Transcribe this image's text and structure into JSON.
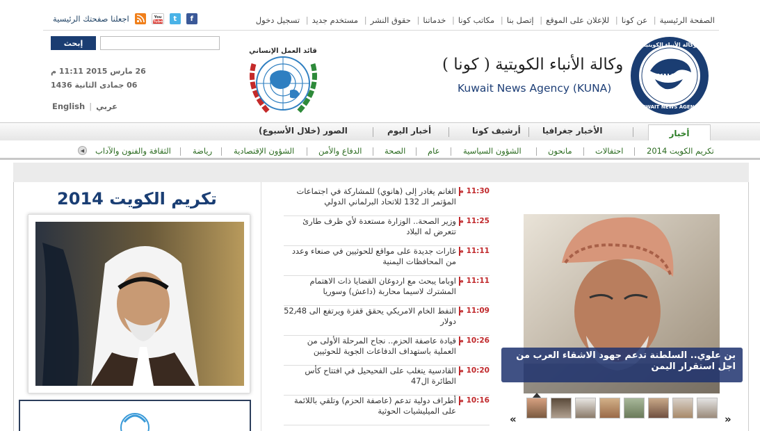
{
  "top_links": [
    "الصفحة الرئيسية",
    "عن كونا",
    "للإعلان على الموقع",
    "إتصل بنا",
    "مكاتب كونا",
    "خدماتنا",
    "حقوق النشر",
    "مستخدم جديد",
    "تسجيل دخول"
  ],
  "social": {
    "home_link": "اجعلنا صفحتك الرئيسية",
    "icons": [
      "rss-icon",
      "youtube-icon",
      "twitter-icon",
      "facebook-icon"
    ],
    "youtube_label": "You Tube"
  },
  "header": {
    "agency_ar": "وكالة الأنباء الكويتية ( كونا )",
    "agency_en": "Kuwait News Agency (KUNA)",
    "logo_text_top": "وكالة الأنباء الكويتية",
    "logo_text_mid": "KUNA",
    "logo_text_bottom": "KUWAIT NEWS AGENCY",
    "un_logo_text": "قائد العمل الإنساني",
    "search_button": "إبحث",
    "search_placeholder": "",
    "date_gregorian": "26 مارس 2015 11:11 م",
    "date_hijri": "06 جمادى الثانية 1436",
    "lang_en": "English",
    "lang_ar": "عربي"
  },
  "nav": {
    "tabs": [
      "أخبار",
      "الأخبار جغرافيا",
      "أرشيف كونا",
      "أخبار اليوم",
      "الصور (خلال الأسبوع)"
    ]
  },
  "subnav": {
    "items": [
      "تكريم الكويت 2014",
      "احتفالات",
      "مانحون",
      "الشؤون السياسية",
      "عام",
      "الصحة",
      "الدفاع والأمن",
      "الشؤون الإقتصادية",
      "رياضة",
      "الثقافة والفنون والآداب"
    ]
  },
  "left": {
    "title": "تكريم الكويت 2014"
  },
  "news": [
    {
      "time": "11:30 م",
      "text": "الغانم يغادر إلى (هانوي) للمشاركة في اجتماعات المؤتمر الـ 132 للاتحاد البرلماني الدولي"
    },
    {
      "time": "11:25 م",
      "text": "وزير الصحة.. الوزارة مستعدة لأي ظرف طارئ تتعرض له البلاد"
    },
    {
      "time": "11:11 م",
      "text": "غارات جديدة على مواقع للحوثيين في صنعاء وعدد من المحافظات اليمنية"
    },
    {
      "time": "11:11 م",
      "text": "اوباما يبحث مع اردوغان القضايا ذات الاهتمام المشترك لاسيما محاربة (داعش) وسوريا"
    },
    {
      "time": "11:09 م",
      "text": "النفط الخام الامريكي يحقق قفزة ويرتفع الى 52٫48 دولار"
    },
    {
      "time": "10:26 م",
      "text": "قيادة عاصفة الحزم.. نجاح المرحلة الأولى من العملية باستهداف الدفاعات الجوية للحوثيين"
    },
    {
      "time": "10:20 م",
      "text": "القادسية يتغلب على الفحيحيل في افتتاح كأس الطائرة ال47"
    },
    {
      "time": "10:16 م",
      "text": "أطراف دولية تدعم (عاصفة الحزم) وتلقي باللائمة على الميليشيات الحوثية"
    }
  ],
  "feature": {
    "caption": "بن علوي.. السلطنة تدعم جهود الاشقاء العرب من اجل استقرار اليمن",
    "prev_arrow": "«",
    "next_arrow": "»"
  },
  "colors": {
    "navy": "#1a3d72",
    "green": "#2a7c24",
    "red": "#c0282b"
  }
}
